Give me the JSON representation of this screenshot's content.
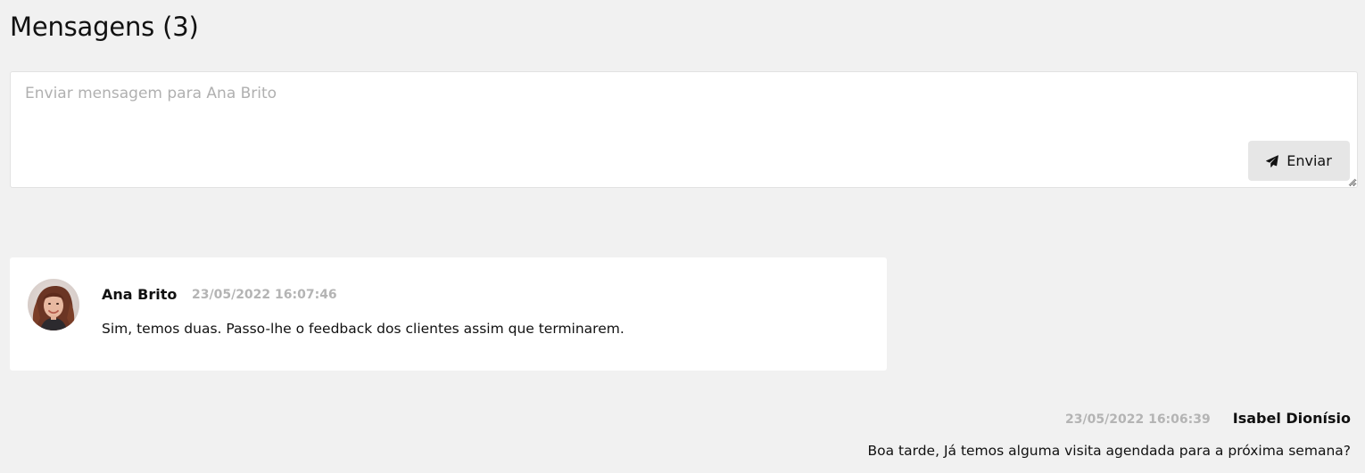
{
  "page": {
    "title": "Mensagens (3)"
  },
  "compose": {
    "placeholder": "Enviar mensagem para Ana Brito",
    "value": "",
    "send_label": "Enviar",
    "send_icon": "paper-plane-icon"
  },
  "messages": [
    {
      "author": "Ana Brito",
      "timestamp": "23/05/2022 16:07:46",
      "text": "Sim, temos duas. Passo-lhe o feedback dos clientes assim que terminarem.",
      "side": "left",
      "has_avatar": true
    },
    {
      "author": "Isabel Dionísio",
      "timestamp": "23/05/2022 16:06:39",
      "text": "Boa tarde, Já temos alguma visita agendada para a próxima semana?",
      "side": "right",
      "has_avatar": false
    }
  ],
  "colors": {
    "background": "#f1f1f1",
    "card": "#ffffff",
    "timestamp": "#b4b4b4",
    "button": "#e6e6e6"
  }
}
